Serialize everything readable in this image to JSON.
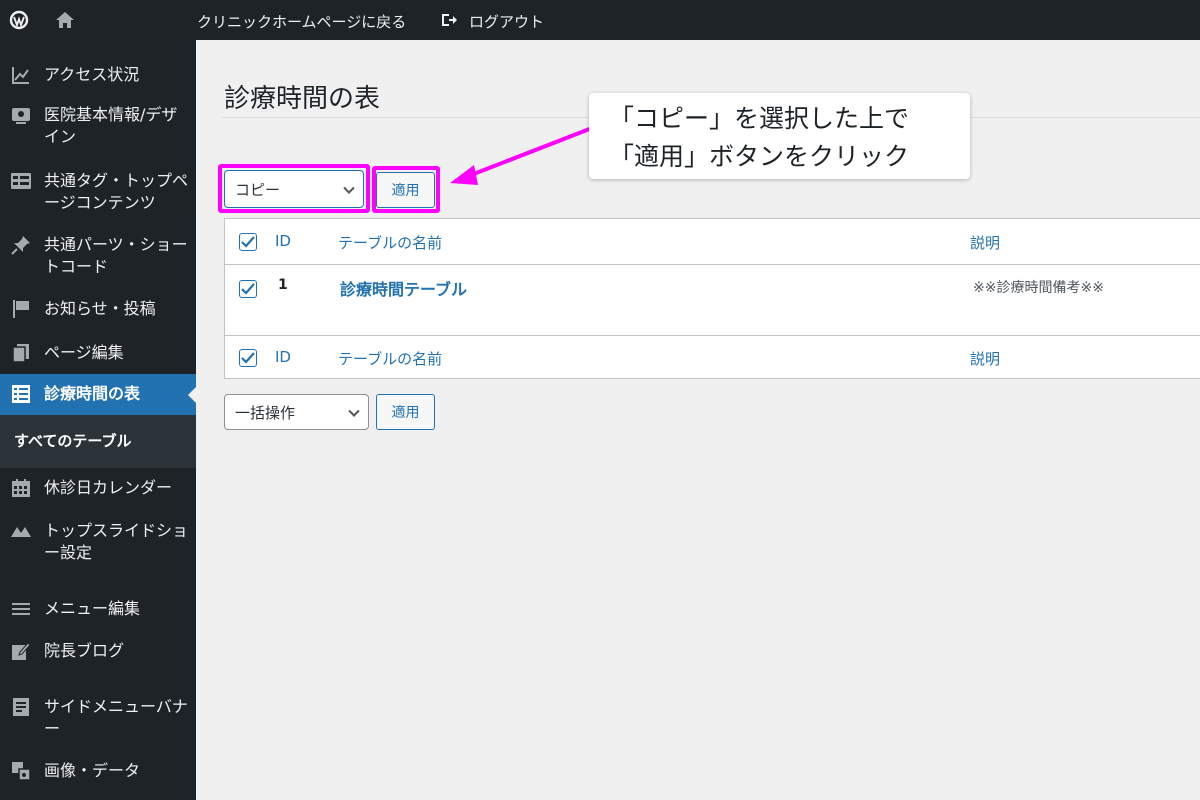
{
  "topbar": {
    "back_link": "クリニックホームページに戻る",
    "logout": "ログアウト"
  },
  "sidebar": {
    "items": [
      {
        "label": "アクセス状況",
        "icon": "chart-icon"
      },
      {
        "label": "医院基本情報/デザイン",
        "icon": "id-card-icon"
      },
      {
        "label": "共通タグ・トップページコンテンツ",
        "icon": "layout-icon"
      },
      {
        "label": "共通パーツ・ショートコード",
        "icon": "pin-icon"
      },
      {
        "label": "お知らせ・投稿",
        "icon": "flag-icon"
      },
      {
        "label": "ページ編集",
        "icon": "pages-icon"
      },
      {
        "label": "診療時間の表",
        "icon": "table-icon"
      },
      {
        "label": "休診日カレンダー",
        "icon": "calendar-icon"
      },
      {
        "label": "トップスライドショー設定",
        "icon": "slides-icon"
      },
      {
        "label": "メニュー編集",
        "icon": "menu-icon"
      },
      {
        "label": "院長ブログ",
        "icon": "edit-icon"
      },
      {
        "label": "サイドメニューバナー",
        "icon": "document-icon"
      },
      {
        "label": "画像・データ",
        "icon": "media-icon"
      }
    ],
    "submenu": {
      "label": "すべてのテーブル"
    }
  },
  "main": {
    "title": "診療時間の表",
    "bulk_top": {
      "selected": "コピー",
      "apply": "適用"
    },
    "bulk_bottom": {
      "selected": "一括操作",
      "apply": "適用"
    },
    "table": {
      "columns": {
        "id": "ID",
        "name": "テーブルの名前",
        "description": "説明"
      },
      "rows": [
        {
          "id": "1",
          "name": "診療時間テーブル",
          "description": "※※診療時間備考※※",
          "checked": true
        }
      ]
    }
  },
  "callout": {
    "line1": "「コピー」を選択した上で",
    "line2": "「適用」ボタンをクリック"
  },
  "colors": {
    "accent": "#2271b1",
    "highlight": "#ff00ff",
    "sidebar": "#1d2327"
  }
}
